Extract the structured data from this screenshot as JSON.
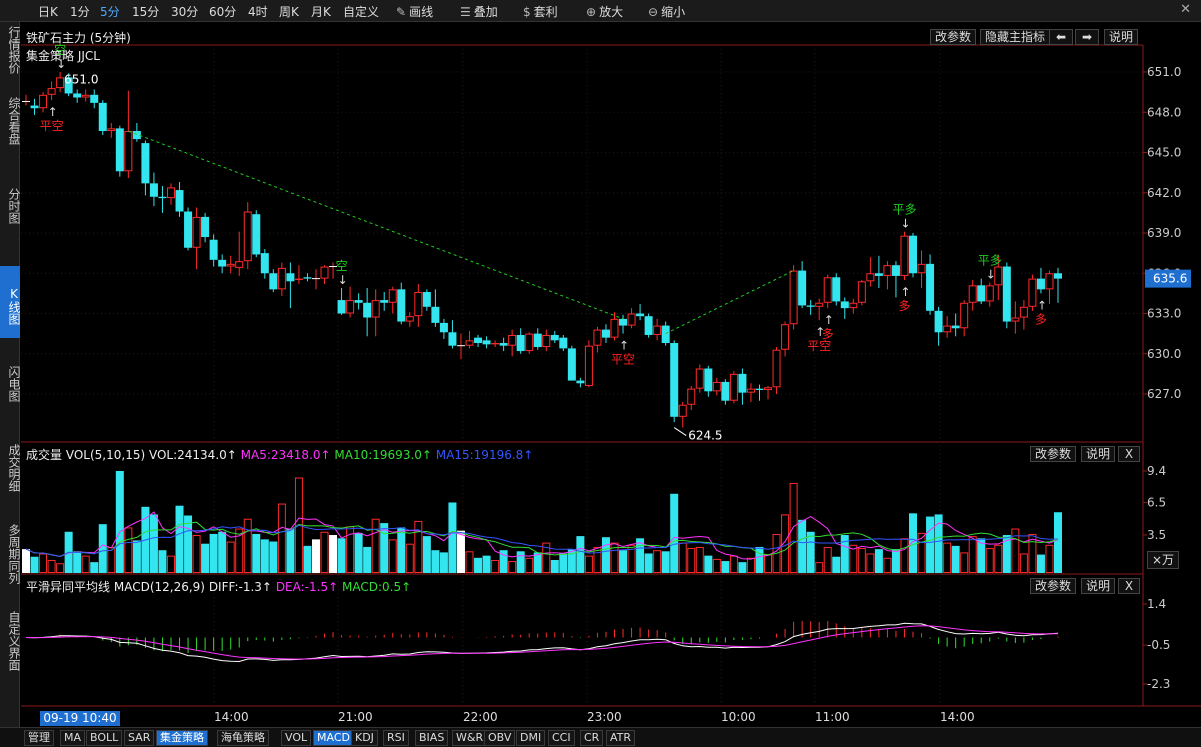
{
  "toolbar": {
    "items": [
      "日K",
      "1分",
      "5分",
      "15分",
      "30分",
      "60分",
      "4时",
      "周K",
      "月K",
      "自定义",
      "画线",
      "叠加",
      "套利",
      "放大",
      "缩小"
    ],
    "active": "5分",
    "icons": {
      "画线": "pencil-icon",
      "叠加": "layers-icon",
      "套利": "money-bag-icon",
      "放大": "zoom-in-icon",
      "缩小": "zoom-out-icon"
    }
  },
  "sidebar": {
    "items": [
      "行情报价",
      "综合看盘",
      "分时图",
      "K线图",
      "闪电图",
      "成交明细",
      "多周期同列",
      "自定义界面"
    ],
    "active": "K线图"
  },
  "main_panel": {
    "title": "铁矿石主力 (5分钟)",
    "strategy": "集金策略 JJCL",
    "buttons": [
      "改参数",
      "隐藏主指标",
      "说明"
    ],
    "left_icon": "arrow-left-icon",
    "right_icon": "arrow-right-icon",
    "price_axis": [
      "651.0",
      "648.0",
      "645.0",
      "642.0",
      "639.0",
      "636.0",
      "633.0",
      "630.0",
      "627.0"
    ],
    "current_price": "635.6",
    "high_label": "651.0",
    "low_label": "624.5",
    "signals": [
      {
        "text": "空",
        "color": "#22cc22"
      },
      {
        "text": "平空",
        "color": "#ff2222"
      },
      {
        "text": "空",
        "color": "#22cc22"
      },
      {
        "text": "平空",
        "color": "#ff2222"
      },
      {
        "text": "平空",
        "color": "#ff2222"
      },
      {
        "text": "多",
        "color": "#ff2222"
      },
      {
        "text": "平多",
        "color": "#22cc22"
      },
      {
        "text": "多",
        "color": "#ff2222"
      },
      {
        "text": "平多",
        "color": "#22cc22"
      },
      {
        "text": "多",
        "color": "#ff2222"
      }
    ]
  },
  "vol_panel": {
    "title": "成交量",
    "params": "VOL(5,10,15)",
    "vol": "VOL:24134.0↑",
    "ma5": "MA5:23418.0↑",
    "ma10": "MA10:19693.0↑",
    "ma15": "MA15:19196.8↑",
    "buttons": [
      "改参数",
      "说明",
      "X"
    ],
    "axis": [
      "9.4",
      "6.5",
      "3.5"
    ],
    "unit": "×万",
    "colors": {
      "ma5": "#ff33ff",
      "ma10": "#33dd33",
      "ma15": "#3355ff"
    }
  },
  "macd_panel": {
    "title": "平滑异同平均线",
    "params": "MACD(12,26,9)",
    "diff": "DIFF:-1.3↑",
    "dea": "DEA:-1.5↑",
    "macd": "MACD:0.5↑",
    "buttons": [
      "改参数",
      "说明",
      "X"
    ],
    "axis": [
      "1.4",
      "-0.5",
      "-2.3"
    ],
    "colors": {
      "dea": "#ff33ff",
      "macd": "#33dd33"
    }
  },
  "time_axis": {
    "cursor": "09-19 10:40",
    "labels": [
      "14:00",
      "21:00",
      "22:00",
      "23:00",
      "10:00",
      "11:00",
      "14:00"
    ]
  },
  "indicator_tabs": {
    "items": [
      "管理",
      "MA",
      "BOLL",
      "SAR",
      "集金策略",
      "海龟策略",
      "VOL",
      "MACD",
      "KDJ",
      "RSI",
      "BIAS",
      "W&R",
      "OBV",
      "DMI",
      "CCI",
      "CR",
      "ATR"
    ],
    "active": [
      "集金策略",
      "MACD"
    ]
  },
  "chart_data": {
    "type": "candlestick",
    "ohlc": [
      [
        648.8,
        649.3,
        648.5,
        648.8
      ],
      [
        648.5,
        649.0,
        647.8,
        648.3
      ],
      [
        648.3,
        649.5,
        648.0,
        649.3
      ],
      [
        649.3,
        650.3,
        648.9,
        649.8
      ],
      [
        649.8,
        651.0,
        649.5,
        650.6
      ],
      [
        650.6,
        650.9,
        649.2,
        649.4
      ],
      [
        649.4,
        649.7,
        648.7,
        649.1
      ],
      [
        649.1,
        649.7,
        648.8,
        649.3
      ],
      [
        649.3,
        649.7,
        648.3,
        648.7
      ],
      [
        648.7,
        648.9,
        646.3,
        646.6
      ],
      [
        646.6,
        647.2,
        646.1,
        646.8
      ],
      [
        646.8,
        647.0,
        643.2,
        643.6
      ],
      [
        643.6,
        649.6,
        643.1,
        646.6
      ],
      [
        646.6,
        647.2,
        645.8,
        646.0
      ],
      [
        645.7,
        645.9,
        641.8,
        642.7
      ],
      [
        642.7,
        643.5,
        641.0,
        641.7
      ],
      [
        641.7,
        642.5,
        640.5,
        641.6
      ],
      [
        641.6,
        642.7,
        641.1,
        642.4
      ],
      [
        642.2,
        642.8,
        640.2,
        640.6
      ],
      [
        640.6,
        640.9,
        637.7,
        637.9
      ],
      [
        637.9,
        640.9,
        636.3,
        640.2
      ],
      [
        640.2,
        640.5,
        638.3,
        638.7
      ],
      [
        638.5,
        638.9,
        636.5,
        637.0
      ],
      [
        637.0,
        637.4,
        636.0,
        636.5
      ],
      [
        636.5,
        637.3,
        636.0,
        636.7
      ],
      [
        636.4,
        639.1,
        635.8,
        636.9
      ],
      [
        636.9,
        641.3,
        636.3,
        640.6
      ],
      [
        640.4,
        640.7,
        637.2,
        637.4
      ],
      [
        637.5,
        637.8,
        635.6,
        636.0
      ],
      [
        636.0,
        636.3,
        634.6,
        634.8
      ],
      [
        634.8,
        636.8,
        634.3,
        636.4
      ],
      [
        636.0,
        636.8,
        633.4,
        635.4
      ],
      [
        635.5,
        636.6,
        635.2,
        635.6
      ],
      [
        635.7,
        636.0,
        635.4,
        635.6
      ],
      [
        635.6,
        636.3,
        634.8,
        635.6
      ],
      [
        635.6,
        636.6,
        635.2,
        636.5
      ],
      [
        636.5,
        636.8,
        635.6,
        636.5
      ],
      [
        634.0,
        634.9,
        632.9,
        633.0
      ],
      [
        633.0,
        635.0,
        632.7,
        634.0
      ],
      [
        634.0,
        634.5,
        633.3,
        633.8
      ],
      [
        633.8,
        634.9,
        631.3,
        632.7
      ],
      [
        632.7,
        634.8,
        631.3,
        634.0
      ],
      [
        634.0,
        634.6,
        633.2,
        633.8
      ],
      [
        633.8,
        635.0,
        633.0,
        634.8
      ],
      [
        634.8,
        635.3,
        632.2,
        632.4
      ],
      [
        632.4,
        633.1,
        632.0,
        632.8
      ],
      [
        632.8,
        635.2,
        632.0,
        634.6
      ],
      [
        634.6,
        634.8,
        633.2,
        633.5
      ],
      [
        633.5,
        634.8,
        632.0,
        632.3
      ],
      [
        632.3,
        632.6,
        631.1,
        631.6
      ],
      [
        631.6,
        632.5,
        630.4,
        630.6
      ],
      [
        630.6,
        631.5,
        629.6,
        630.6
      ],
      [
        630.6,
        631.7,
        630.4,
        631.0
      ],
      [
        631.2,
        631.4,
        630.5,
        630.8
      ],
      [
        631.0,
        631.3,
        630.4,
        630.7
      ],
      [
        630.7,
        631.0,
        630.5,
        630.8
      ],
      [
        630.8,
        631.2,
        630.2,
        630.6
      ],
      [
        630.6,
        631.8,
        629.8,
        631.4
      ],
      [
        631.4,
        631.9,
        630.0,
        630.2
      ],
      [
        630.2,
        631.6,
        630.0,
        631.5
      ],
      [
        631.5,
        631.9,
        630.3,
        630.5
      ],
      [
        630.5,
        631.8,
        630.2,
        631.4
      ],
      [
        631.4,
        631.7,
        630.8,
        631.0
      ],
      [
        631.2,
        631.4,
        630.2,
        630.4
      ],
      [
        630.4,
        630.6,
        628.0,
        628.0
      ],
      [
        628.0,
        628.2,
        627.5,
        627.8
      ],
      [
        627.6,
        631.0,
        627.5,
        630.6
      ],
      [
        630.6,
        632.0,
        630.1,
        631.8
      ],
      [
        631.8,
        632.2,
        630.8,
        631.2
      ],
      [
        631.2,
        633.1,
        631.0,
        632.6
      ],
      [
        632.6,
        632.9,
        631.5,
        632.1
      ],
      [
        632.1,
        633.4,
        631.9,
        633.0
      ],
      [
        633.0,
        633.7,
        632.5,
        632.8
      ],
      [
        632.8,
        633.0,
        631.2,
        631.4
      ],
      [
        631.4,
        632.6,
        631.0,
        632.1
      ],
      [
        632.1,
        632.4,
        630.6,
        630.8
      ],
      [
        630.8,
        631.0,
        624.9,
        625.3
      ],
      [
        625.3,
        626.4,
        624.5,
        626.2
      ],
      [
        626.2,
        627.6,
        625.8,
        627.4
      ],
      [
        627.4,
        629.2,
        627.1,
        628.9
      ],
      [
        628.9,
        629.1,
        626.8,
        627.2
      ],
      [
        627.2,
        628.2,
        626.9,
        627.9
      ],
      [
        627.9,
        628.1,
        626.2,
        626.5
      ],
      [
        626.5,
        628.7,
        626.3,
        628.5
      ],
      [
        628.5,
        628.9,
        626.2,
        627.1
      ],
      [
        627.1,
        627.8,
        626.4,
        627.4
      ],
      [
        627.4,
        627.7,
        626.5,
        627.3
      ],
      [
        627.3,
        627.6,
        626.6,
        627.5
      ],
      [
        627.5,
        630.5,
        627.0,
        630.3
      ],
      [
        630.3,
        632.4,
        629.8,
        632.2
      ],
      [
        632.2,
        636.6,
        631.8,
        636.2
      ],
      [
        636.2,
        636.9,
        633.4,
        633.6
      ],
      [
        633.6,
        634.0,
        632.9,
        633.5
      ],
      [
        633.5,
        634.1,
        632.5,
        633.8
      ],
      [
        633.8,
        635.9,
        633.4,
        635.7
      ],
      [
        635.7,
        636.0,
        633.6,
        633.9
      ],
      [
        633.9,
        634.2,
        632.6,
        633.4
      ],
      [
        633.4,
        634.1,
        633.0,
        633.8
      ],
      [
        633.8,
        635.5,
        633.6,
        635.4
      ],
      [
        635.4,
        637.2,
        635.0,
        636.0
      ],
      [
        636.0,
        637.3,
        634.9,
        635.8
      ],
      [
        635.8,
        636.9,
        634.8,
        636.6
      ],
      [
        636.6,
        636.9,
        634.2,
        635.8
      ],
      [
        635.8,
        639.1,
        635.5,
        638.8
      ],
      [
        638.8,
        639.0,
        635.7,
        636.0
      ],
      [
        636.0,
        637.7,
        634.9,
        636.7
      ],
      [
        636.7,
        637.4,
        632.9,
        633.2
      ],
      [
        633.2,
        633.5,
        630.6,
        631.6
      ],
      [
        631.6,
        632.8,
        631.2,
        632.1
      ],
      [
        632.1,
        633.0,
        631.3,
        631.9
      ],
      [
        631.9,
        634.0,
        631.3,
        633.8
      ],
      [
        633.8,
        635.5,
        633.2,
        635.1
      ],
      [
        635.1,
        635.6,
        633.7,
        633.9
      ],
      [
        633.9,
        635.3,
        633.5,
        635.1
      ],
      [
        635.1,
        637.4,
        634.0,
        636.5
      ],
      [
        636.5,
        636.8,
        631.9,
        632.4
      ],
      [
        632.4,
        633.9,
        631.5,
        632.7
      ],
      [
        632.7,
        634.0,
        631.8,
        633.5
      ],
      [
        633.5,
        635.9,
        633.2,
        635.6
      ],
      [
        635.6,
        636.4,
        634.5,
        634.8
      ],
      [
        634.8,
        636.2,
        633.7,
        636.0
      ],
      [
        636.0,
        636.4,
        633.8,
        635.6
      ]
    ],
    "volume_wan": [
      2.2,
      1.5,
      1.8,
      1.2,
      0.9,
      3.8,
      2.0,
      1.6,
      1.0,
      4.5,
      2.4,
      9.4,
      4.2,
      3.0,
      6.1,
      5.4,
      2.1,
      1.6,
      6.2,
      5.3,
      3.5,
      2.7,
      3.6,
      3.8,
      2.9,
      4.1,
      5.0,
      3.6,
      3.1,
      2.9,
      6.4,
      4.1,
      8.8,
      2.5,
      3.1,
      3.8,
      3.5,
      3.2,
      4.3,
      3.7,
      2.4,
      5.0,
      4.6,
      3.1,
      4.2,
      2.7,
      4.8,
      3.4,
      2.1,
      1.9,
      6.5,
      3.9,
      2.0,
      1.4,
      1.6,
      1.2,
      2.1,
      1.1,
      2.0,
      1.4,
      1.9,
      2.8,
      1.2,
      1.8,
      2.2,
      3.4,
      1.6,
      2.4,
      3.3,
      2.8,
      2.1,
      2.6,
      3.2,
      1.8,
      2.1,
      2.0,
      7.3,
      2.8,
      2.3,
      2.4,
      1.6,
      1.3,
      1.1,
      1.6,
      1.0,
      1.4,
      2.4,
      1.7,
      3.6,
      5.4,
      8.3,
      4.9,
      3.8,
      1.0,
      2.4,
      1.5,
      3.5,
      2.6,
      2.3,
      1.8,
      2.2,
      1.4,
      2.2,
      3.2,
      5.5,
      3.7,
      5.2,
      5.4,
      2.8,
      2.5,
      1.9,
      3.4,
      3.2,
      2.3,
      2.6,
      3.5,
      4.1,
      1.8,
      3.6,
      1.7,
      2.6,
      5.6
    ],
    "macd_levels": [
      -1.5,
      -1.0,
      -0.4,
      0.2,
      0.8,
      1.4
    ],
    "signal_positions": [
      4,
      3,
      37,
      70,
      93,
      94,
      103,
      103,
      113,
      119
    ]
  }
}
